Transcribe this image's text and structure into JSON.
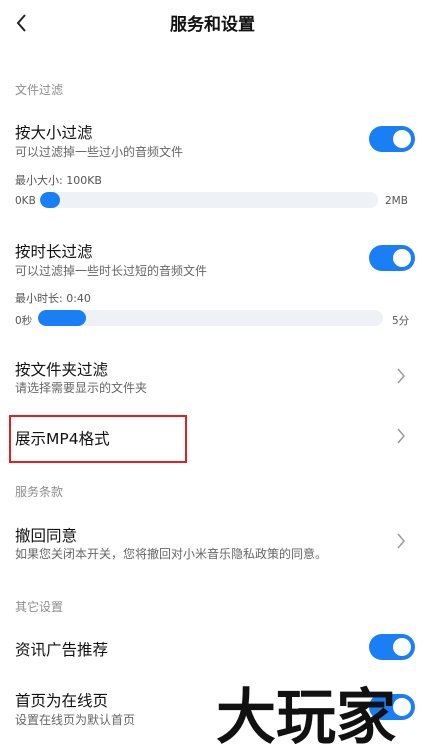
{
  "header": {
    "title": "服务和设置",
    "back_icon": "back-arrow-icon"
  },
  "file_filter": {
    "section_label": "文件过滤",
    "by_size": {
      "title": "按大小过滤",
      "subtitle": "可以过滤掉一些过小的音频文件",
      "enabled": true,
      "current_label": "最小大小: 100KB",
      "min_label": "0KB",
      "max_label": "2MB",
      "fill_fraction": 0.06
    },
    "by_duration": {
      "title": "按时长过滤",
      "subtitle": "可以过滤掉一些时长过短的音频文件",
      "enabled": true,
      "current_label": "最小时长: 0:40",
      "min_label": "0秒",
      "max_label": "5分",
      "fill_fraction": 0.14
    },
    "by_folder": {
      "title": "按文件夹过滤",
      "subtitle": "请选择需要显示的文件夹"
    },
    "show_mp4": {
      "title": "展示MP4格式"
    }
  },
  "terms": {
    "section_label": "服务条款",
    "revoke": {
      "title": "撤回同意",
      "subtitle": "如果您关闭本开关，您将撤回对小米音乐隐私政策的同意。"
    }
  },
  "other": {
    "section_label": "其它设置",
    "ads": {
      "title": "资讯广告推荐",
      "enabled": true
    },
    "home_online": {
      "title": "首页为在线页",
      "subtitle": "设置在线页为默认首页",
      "enabled": true
    }
  },
  "watermark": {
    "text": "大玩家"
  },
  "colors": {
    "accent": "#1a7ff5",
    "highlight": "#e02020"
  }
}
